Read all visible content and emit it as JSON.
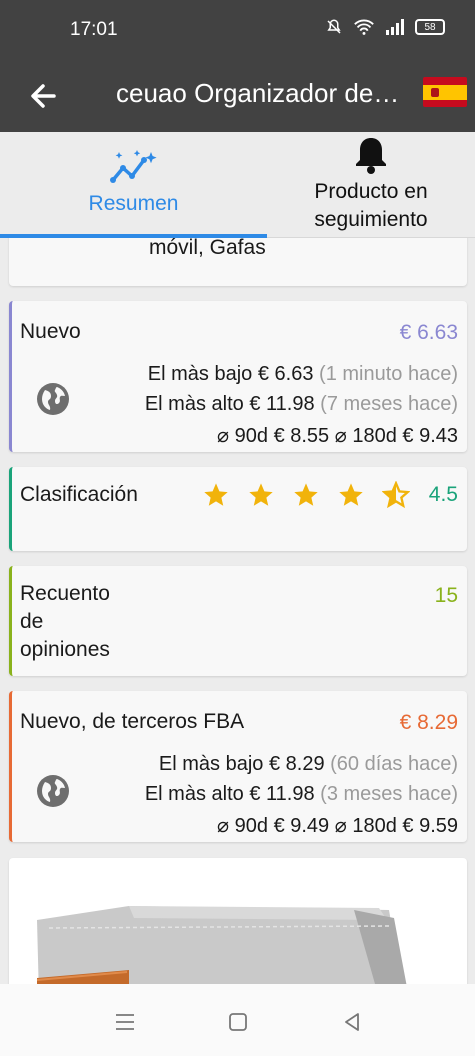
{
  "status_bar": {
    "time": "17:01",
    "battery": "58"
  },
  "app_bar": {
    "title": "ceuao Organizador de móvil, Gafas",
    "flag": "spain-flag"
  },
  "tabs": [
    {
      "label": "Resumen",
      "icon": "chart-sparkle-icon",
      "selected": true
    },
    {
      "label": "Producto en seguimiento",
      "icon": "bell-icon",
      "selected": false
    }
  ],
  "summary_top": {
    "text": "móvil, Gafas"
  },
  "new_price": {
    "title": "Nuevo",
    "price": "€ 6.63",
    "lowest_label": "El màs bajo",
    "lowest_value": "€ 6.63",
    "lowest_ago": "(1 minuto hace)",
    "highest_label": "El màs alto",
    "highest_value": "€ 11.98",
    "highest_ago": "(7 meses hace)",
    "avg90_label": "⌀ 90d",
    "avg90_value": "€ 8.55",
    "avg180_label": "⌀ 180d",
    "avg180_value": "€ 9.43",
    "accent": "#8a87d1"
  },
  "rating": {
    "title": "Clasificación",
    "value": "4.5",
    "stars": 4.5,
    "accent": "#1aa37a"
  },
  "reviews": {
    "title": "Recuento de opiniones",
    "value": "15",
    "accent": "#8ab21c"
  },
  "fba_price": {
    "title": "Nuevo, de terceros FBA",
    "price": "€ 8.29",
    "lowest_label": "El màs bajo",
    "lowest_value": "€ 8.29",
    "lowest_ago": "(60 días hace)",
    "highest_label": "El màs alto",
    "highest_value": "€ 11.98",
    "highest_ago": "(3 meses hace)",
    "avg90_label": "⌀ 90d",
    "avg90_value": "€ 9.49",
    "avg180_label": "⌀ 180d",
    "avg180_value": "€ 9.59",
    "accent": "#e76a35"
  }
}
